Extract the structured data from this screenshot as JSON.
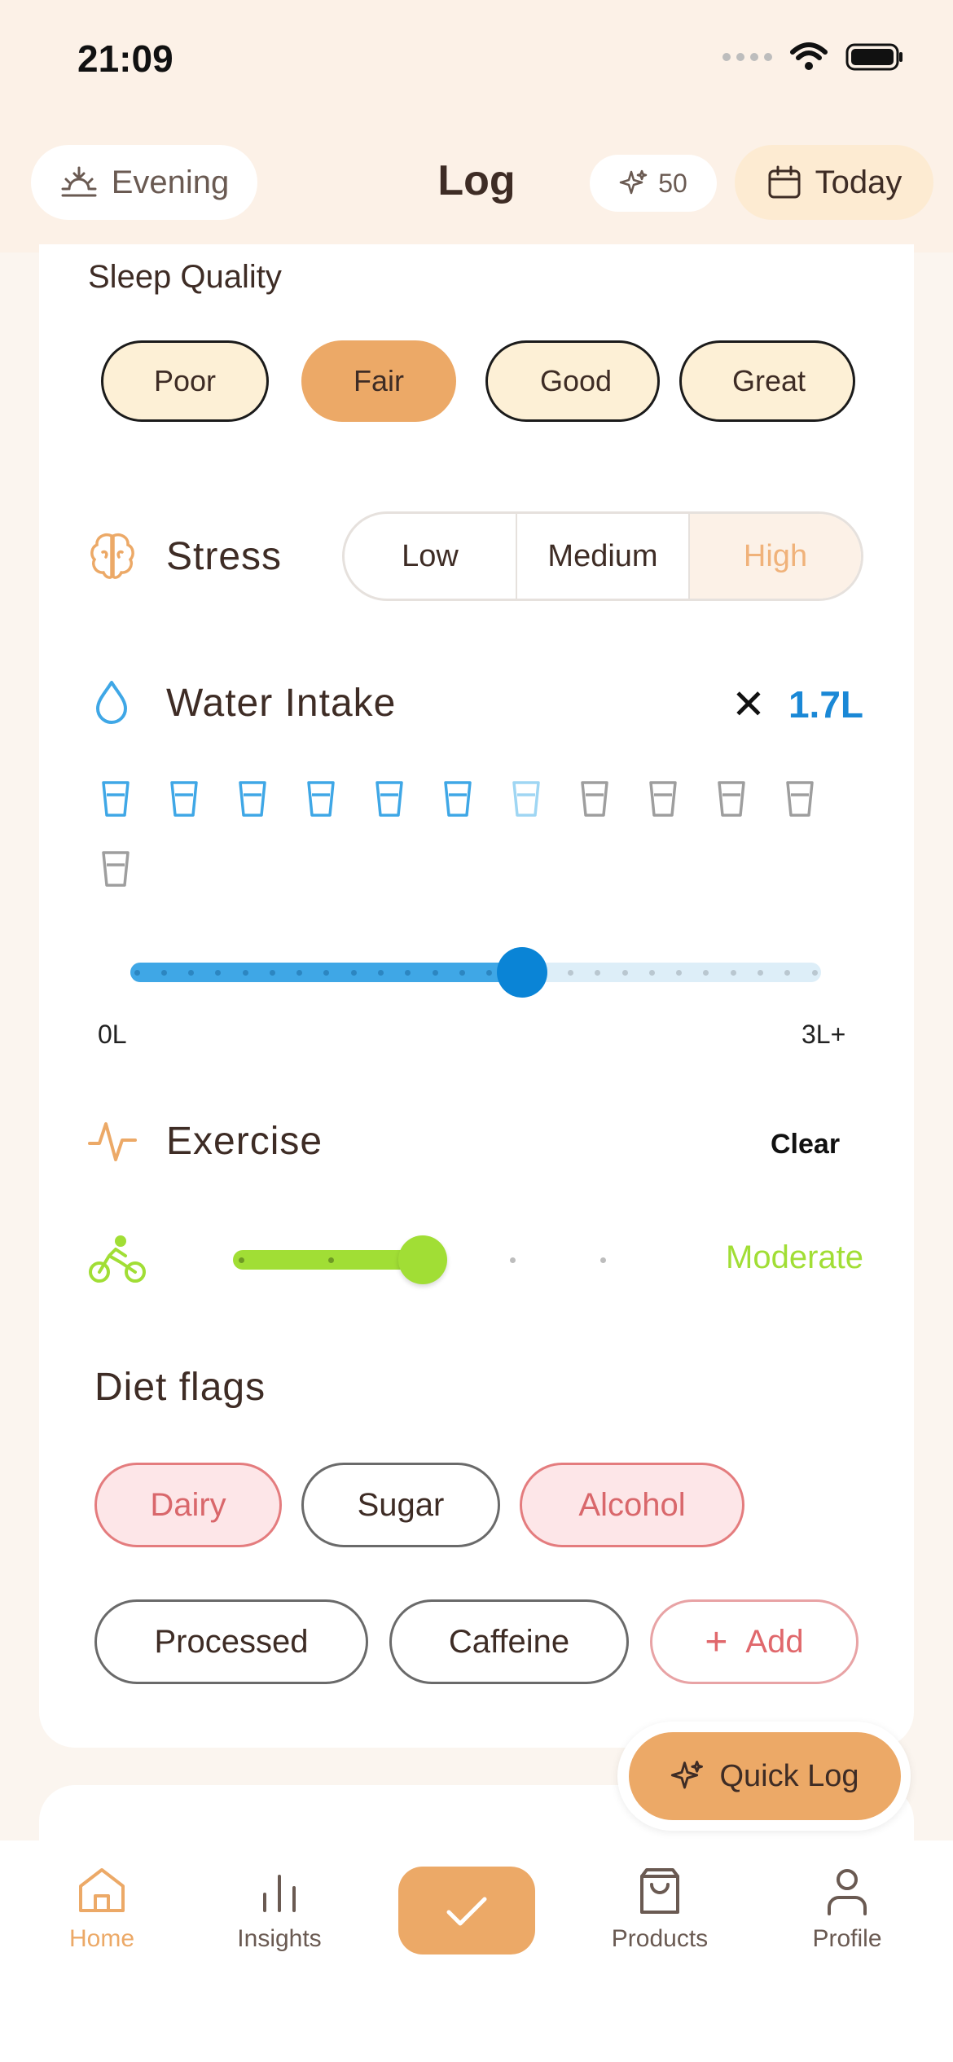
{
  "status_bar": {
    "time": "21:09"
  },
  "header": {
    "period_label": "Evening",
    "title": "Log",
    "points": "50",
    "date_label": "Today"
  },
  "sleep_quality": {
    "label": "Sleep Quality",
    "options": [
      "Poor",
      "Fair",
      "Good",
      "Great"
    ],
    "selected": "Fair"
  },
  "stress": {
    "label": "Stress",
    "options": [
      "Low",
      "Medium",
      "High"
    ],
    "selected": "High"
  },
  "water": {
    "label": "Water Intake",
    "clear_symbol": "✕",
    "value": "1.7L",
    "min_label": "0L",
    "max_label": "3L+",
    "cups_total": 12,
    "cups_filled": 6,
    "cups_partial": 1,
    "slider_fraction": 0.567
  },
  "exercise": {
    "label": "Exercise",
    "clear_label": "Clear",
    "level": "Moderate",
    "slider_fraction": 0.5
  },
  "diet": {
    "label": "Diet flags",
    "chips": [
      "Dairy",
      "Sugar",
      "Alcohol",
      "Processed",
      "Caffeine"
    ],
    "flagged": [
      "Dairy",
      "Alcohol"
    ],
    "add_label": "Add",
    "add_symbol": "+"
  },
  "quick_log": {
    "label": "Quick Log"
  },
  "nav": {
    "items": [
      "Home",
      "Insights",
      "Products",
      "Profile"
    ],
    "active": "Home"
  },
  "colors": {
    "accent": "#ECA967",
    "water": "#0A84D6",
    "exercise": "#A1DE35",
    "flag": "#E47C7E"
  }
}
